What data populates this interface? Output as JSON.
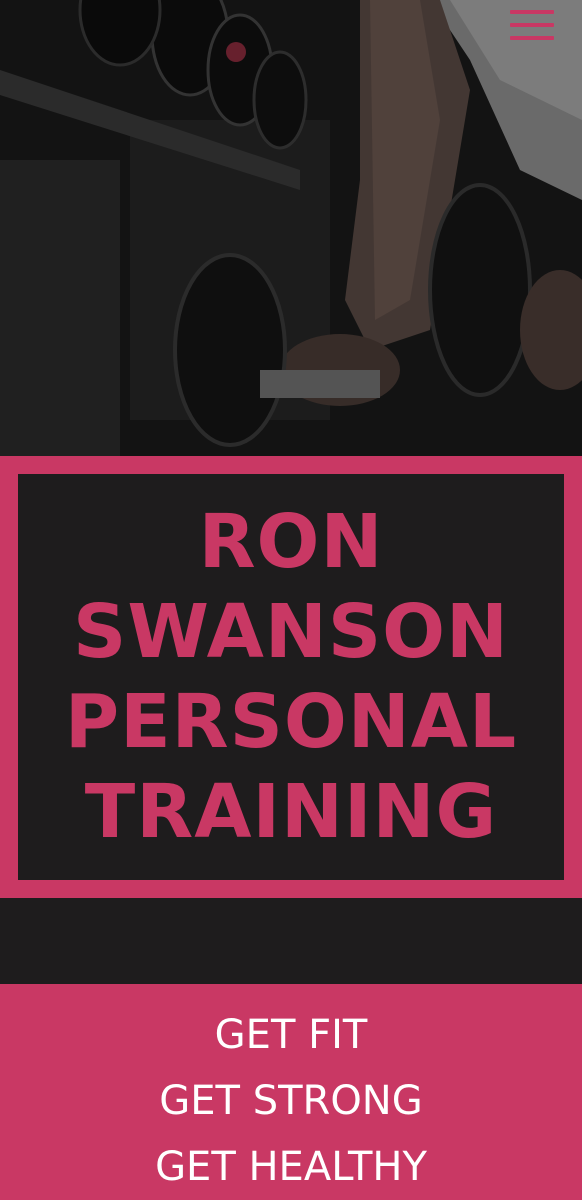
{
  "hero": {
    "image_alt": "gym dumbbells photo",
    "menu_icon": "hamburger-menu-icon"
  },
  "title": {
    "lines": [
      "RON",
      "SWANSON",
      "PERSONAL",
      "TRAINING"
    ]
  },
  "taglines": [
    "GET FIT",
    "GET STRONG",
    "GET HEALTHY"
  ],
  "colors": {
    "accent": "#c93864",
    "dark": "#1e1c1d",
    "text_light": "#ffffff"
  }
}
